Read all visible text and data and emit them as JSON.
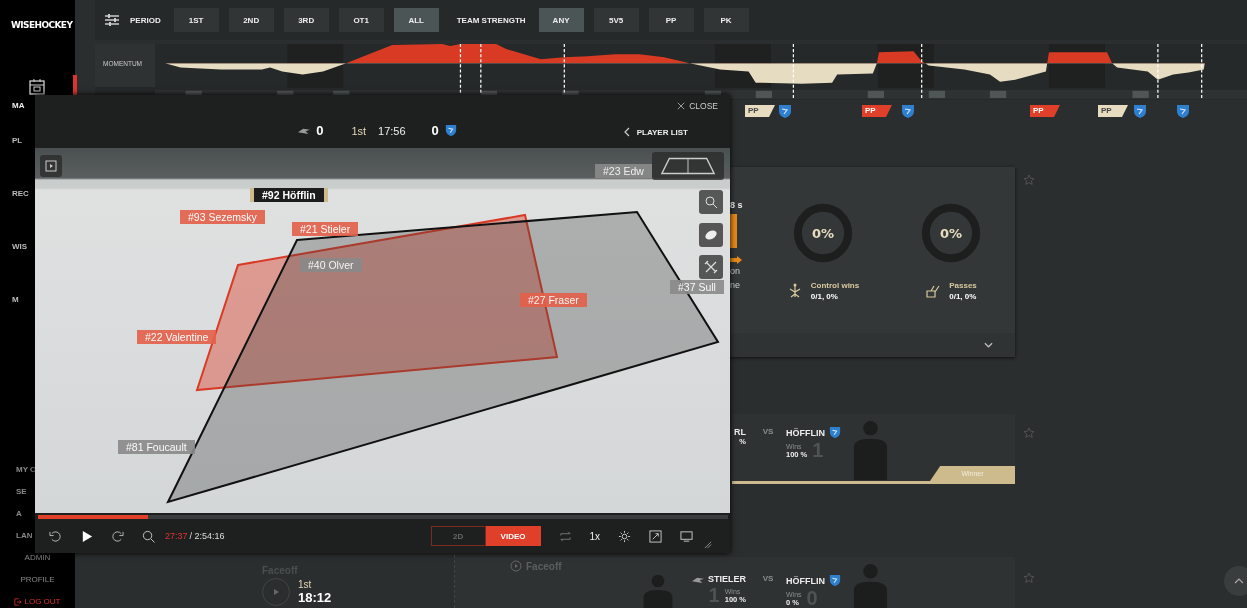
{
  "sidebar": {
    "logo": "WISEHOCKEY",
    "top_items": [
      {
        "label": "MA",
        "selected": true
      },
      {
        "label": "PL",
        "selected": false
      },
      {
        "label": "REC",
        "selected": false
      },
      {
        "label": "WIS",
        "selected": false
      },
      {
        "label": "M",
        "selected": false
      }
    ],
    "bottom_items": [
      "MY C",
      "SE",
      "A",
      "LAN"
    ],
    "admin_items": [
      "ADMIN",
      "PROFILE"
    ],
    "logout": "LOG OUT"
  },
  "filters": {
    "period_label": "PERIOD",
    "periods": [
      {
        "label": "1ST",
        "selected": false
      },
      {
        "label": "2ND",
        "selected": false
      },
      {
        "label": "3RD",
        "selected": false
      },
      {
        "label": "OT1",
        "selected": false
      },
      {
        "label": "ALL",
        "selected": true
      }
    ],
    "strength_label": "TEAM STRENGTH",
    "strengths": [
      {
        "label": "ANY",
        "selected": true
      },
      {
        "label": "5V5",
        "selected": false
      },
      {
        "label": "PP",
        "selected": false
      },
      {
        "label": "PK",
        "selected": false
      }
    ]
  },
  "momentum": {
    "label": "MOMENTUM"
  },
  "timeline_markers": [
    {
      "kind": "tag",
      "label": "PP",
      "color": "#e8dcc0"
    },
    {
      "kind": "goal"
    },
    {
      "kind": "tag",
      "label": "PP",
      "color": "#e0402a"
    },
    {
      "kind": "goal"
    },
    {
      "kind": "tag",
      "label": "PP",
      "color": "#e0402a"
    },
    {
      "kind": "tag",
      "label": "PP",
      "color": "#e8dcc0"
    },
    {
      "kind": "goal"
    },
    {
      "kind": "goal"
    }
  ],
  "stats_card": {
    "cut_texts": [
      "8 s",
      "on",
      "ne"
    ],
    "stats": [
      {
        "percent": "0%",
        "level": 0,
        "label": "Control wins",
        "value": "0/1, 0%"
      },
      {
        "percent": "0%",
        "level": 0,
        "label": "Passes",
        "value": "0/1, 0%"
      }
    ]
  },
  "event": {
    "label": "Faceoff",
    "period": "1st",
    "time": "18:12"
  },
  "faceoffs": [
    {
      "left_name": "RL",
      "left_pct": "%",
      "vs": "VS",
      "right_name": "HÖFFLIN",
      "right_wins_label": "Wins",
      "right_pct": "100 %",
      "right_count": "1",
      "winner": "Winner"
    },
    {
      "event_label": "Faceoff",
      "left_name": "STIELER",
      "left_count": "1",
      "left_wins_label": "Wins",
      "left_pct": "100 %",
      "vs": "VS",
      "right_name": "HÖFFLIN",
      "right_wins_label": "Wins",
      "right_pct": "0 %",
      "right_count": "0"
    }
  ],
  "video_player": {
    "close": "CLOSE",
    "score_home": "0",
    "period": "1st",
    "clock": "17:56",
    "score_away": "0",
    "player_list": "PLAYER LIST",
    "player_labels": [
      {
        "text": "#23 Edw",
        "color": "#8a8a8a",
        "selected": false
      },
      {
        "text": "#92 Höfflin",
        "color": "#1c1c1c",
        "selected": true
      },
      {
        "text": "#93 Sezemsky",
        "color": "#e4604a",
        "selected": false
      },
      {
        "text": "#21 Stieler",
        "color": "#e4604a",
        "selected": false
      },
      {
        "text": "#40 Olver",
        "color": "#8a8a8a",
        "selected": false
      },
      {
        "text": "#37 Sull",
        "color": "#8a8a8a",
        "selected": false
      },
      {
        "text": "#27 Fraser",
        "color": "#e4604a",
        "selected": false
      },
      {
        "text": "#22 Valentine",
        "color": "#e4604a",
        "selected": false
      },
      {
        "text": "#81 Foucault",
        "color": "#8a8a8a",
        "selected": false
      }
    ],
    "progress": {
      "level": 0.16
    },
    "elapsed": "27:37",
    "duration": "/ 2:54:16",
    "view_modes": [
      {
        "label": "2D",
        "selected": false
      },
      {
        "label": "VIDEO",
        "selected": true
      }
    ],
    "speed": "1x"
  }
}
